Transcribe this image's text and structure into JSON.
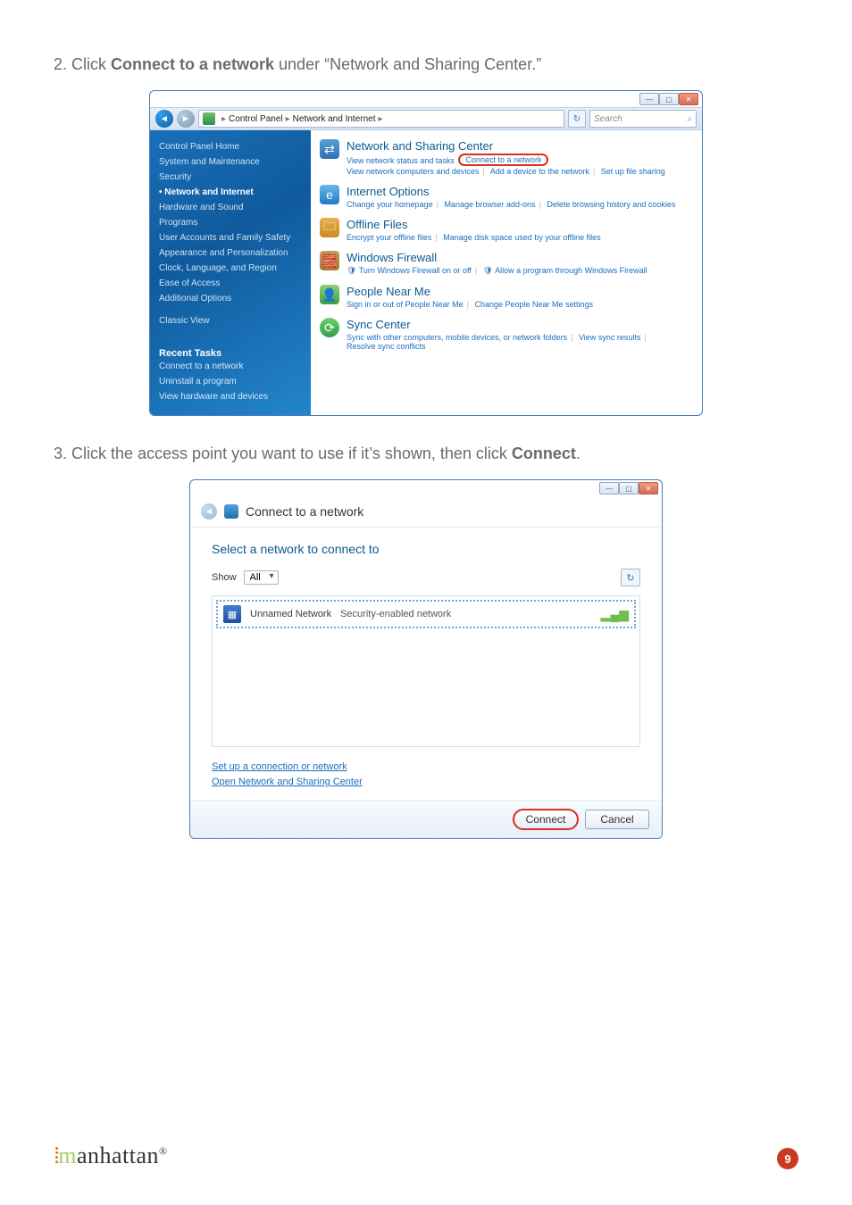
{
  "step2": {
    "prefix": "2. Click ",
    "bold": "Connect to a network",
    "suffix": " under “Network and Sharing Center.”"
  },
  "step3": {
    "prefix": "3. Click the access point you want to use if it’s shown, then click ",
    "bold": "Connect",
    "suffix": "."
  },
  "cp": {
    "breadcrumb": {
      "root": "Control Panel",
      "sub": "Network and Internet",
      "arrow": "›"
    },
    "search_placeholder": "Search",
    "sidebar": {
      "items": [
        {
          "label": "Control Panel Home"
        },
        {
          "label": "System and Maintenance"
        },
        {
          "label": "Security"
        },
        {
          "label": "Network and Internet",
          "active": true
        },
        {
          "label": "Hardware and Sound"
        },
        {
          "label": "Programs"
        },
        {
          "label": "User Accounts and Family Safety"
        },
        {
          "label": "Appearance and Personalization"
        },
        {
          "label": "Clock, Language, and Region"
        },
        {
          "label": "Ease of Access"
        },
        {
          "label": "Additional Options"
        },
        {
          "label": "Classic View"
        }
      ],
      "recent_title": "Recent Tasks",
      "recent": [
        {
          "label": "Connect to a network"
        },
        {
          "label": "Uninstall a program"
        },
        {
          "label": "View hardware and devices"
        }
      ]
    },
    "cats": {
      "net": {
        "title": "Network and Sharing Center",
        "l1": "View network status and tasks",
        "l2_highlight": "Connect to a network",
        "l3a": "View network computers and devices",
        "l3b": "Add a device to the network",
        "l3c": "Set up file sharing"
      },
      "ie": {
        "title": "Internet Options",
        "l1": "Change your homepage",
        "l2": "Manage browser add-ons",
        "l3": "Delete browsing history and cookies"
      },
      "off": {
        "title": "Offline Files",
        "l1": "Encrypt your offline files",
        "l2": "Manage disk space used by your offline files"
      },
      "fw": {
        "title": "Windows Firewall",
        "l1": "Turn Windows Firewall on or off",
        "l2": "Allow a program through Windows Firewall"
      },
      "ppl": {
        "title": "People Near Me",
        "l1": "Sign in or out of People Near Me",
        "l2": "Change People Near Me settings"
      },
      "syn": {
        "title": "Sync Center",
        "l1": "Sync with other computers, mobile devices, or network folders",
        "l2": "View sync results",
        "l3": "Resolve sync conflicts"
      }
    }
  },
  "conn": {
    "header": "Connect to a network",
    "title": "Select a network to connect to",
    "show_label": "Show",
    "show_value": "All",
    "net": {
      "name": "Unnamed Network",
      "desc": "Security-enabled network"
    },
    "link1": "Set up a connection or network",
    "link2": "Open Network and Sharing Center",
    "btn_connect": "Connect",
    "btn_cancel": "Cancel"
  },
  "footer": {
    "brand": "manhattan",
    "page": "9"
  }
}
